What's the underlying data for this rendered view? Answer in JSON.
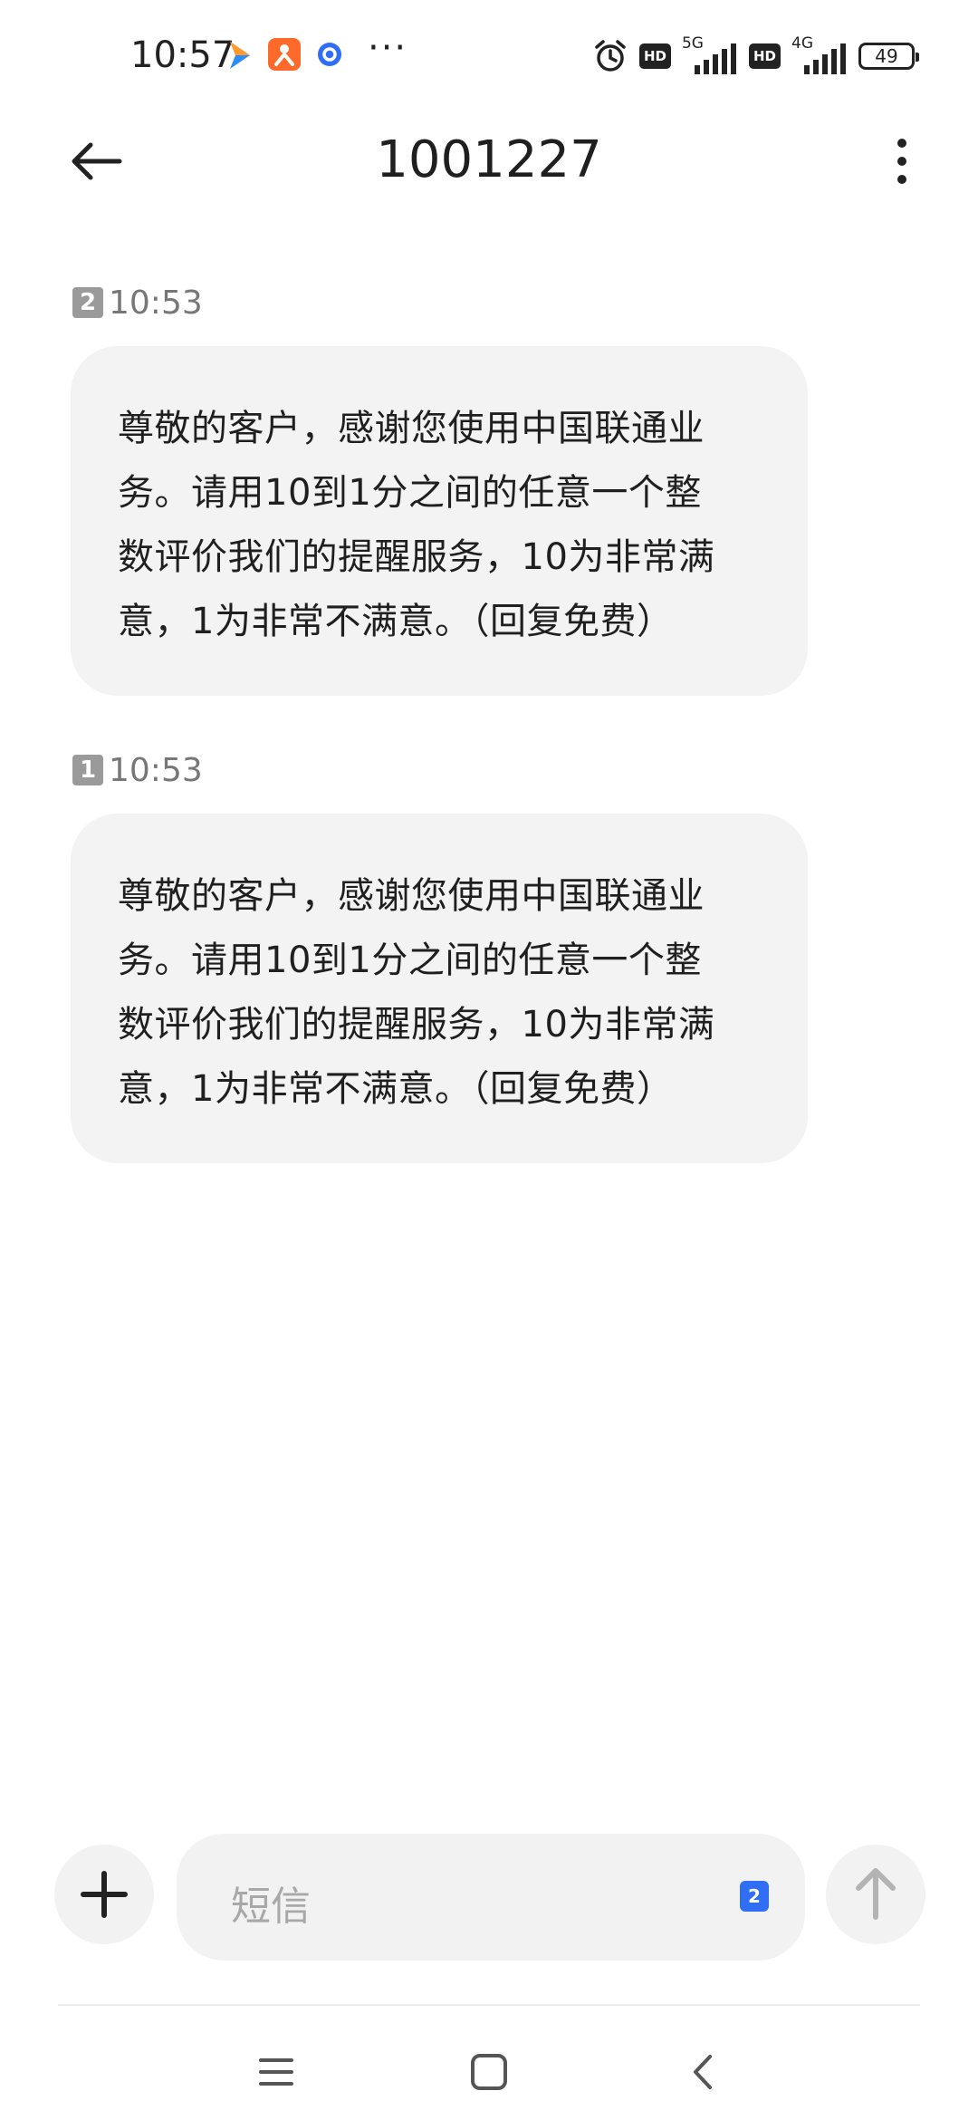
{
  "status_bar": {
    "time": "10:57",
    "more_dots": "···",
    "hd_label_1": "HD",
    "network_1": "5G",
    "hd_label_2": "HD",
    "network_2": "4G",
    "battery_level": "49",
    "icons": [
      "arrow-app-icon",
      "orange-app-icon",
      "blue-app-icon",
      "alarm-icon",
      "signal-icon",
      "battery-icon"
    ]
  },
  "header": {
    "title": "1001227",
    "back_icon": "arrow-left-icon",
    "more_icon": "more-vertical-icon"
  },
  "messages": [
    {
      "sim": "2",
      "time": "10:53",
      "lines": [
        "尊敬的客户，感谢您使用中国联通业",
        "务。请用10到1分之间的任意一个整",
        "数评价我们的提醒服务，10为非常满",
        "意，1为非常不满意。（回复免费）"
      ]
    },
    {
      "sim": "1",
      "time": "10:53",
      "lines": [
        "尊敬的客户，感谢您使用中国联通业",
        "务。请用10到1分之间的任意一个整",
        "数评价我们的提醒服务，10为非常满",
        "意，1为非常不满意。（回复免费）"
      ]
    }
  ],
  "composer": {
    "placeholder": "短信",
    "sim_selected": "2",
    "attach_icon": "plus-icon",
    "send_icon": "arrow-up-icon"
  },
  "nav_bar": {
    "icons": [
      "menu-icon",
      "home-icon",
      "back-icon"
    ]
  },
  "colors": {
    "bubble": "#f3f3f3",
    "sim_badge": "#9a9a9a",
    "sim_select": "#2f6ef5",
    "orange_app": "#ff6a2b"
  }
}
